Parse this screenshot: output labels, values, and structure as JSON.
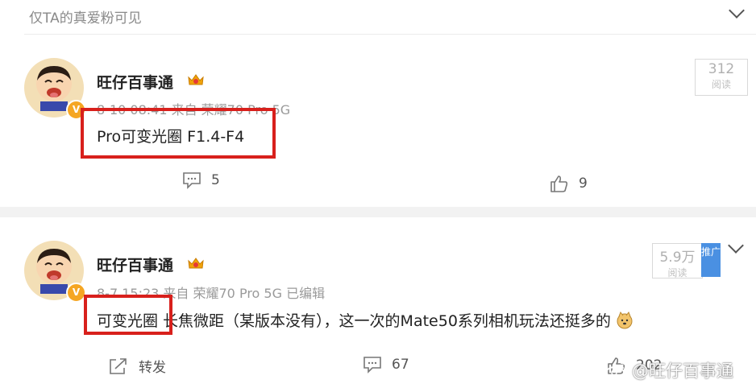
{
  "top": {
    "visibility_note": "仅TA的真爱粉可见"
  },
  "posts": [
    {
      "author": "旺仔百事通",
      "meta": "8-10 08:41  来自 荣耀70 Pro 5G",
      "content": "Pro可变光圈 F1.4-F4",
      "reads": {
        "count": "312",
        "label": "阅读"
      },
      "comments": "5",
      "likes": "9"
    },
    {
      "author": "旺仔百事通",
      "meta": "8-7 15:23  来自 荣耀70 Pro 5G 已编辑",
      "content_highlight": "可变光圈",
      "content_rest": "  长焦微距（某版本没有），这一次的Mate50系列相机玩法还挺多的",
      "reads": {
        "count": "5.9万",
        "label": "阅读"
      },
      "promote": "推广",
      "forward": "转发",
      "comments": "67",
      "likes": "202"
    }
  ],
  "watermark": "@旺仔百事通",
  "colors": {
    "highlight_border": "#d8201c",
    "badge": "#f5a623",
    "promote": "#4a90e2"
  }
}
